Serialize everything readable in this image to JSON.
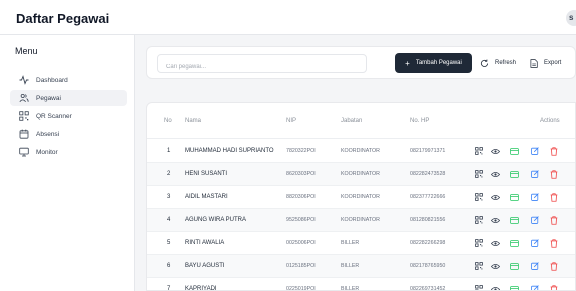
{
  "app": {
    "title": "Daftar Pegawai",
    "avatar_initial": "s"
  },
  "sidebar": {
    "menu_title": "Menu",
    "items": [
      {
        "label": "Dashboard",
        "icon": "activity-icon",
        "active": false
      },
      {
        "label": "Pegawai",
        "icon": "users-icon",
        "active": true
      },
      {
        "label": "QR Scanner",
        "icon": "qr-code-icon",
        "active": false
      },
      {
        "label": "Absensi",
        "icon": "calendar-icon",
        "active": false
      },
      {
        "label": "Monitor",
        "icon": "monitor-icon",
        "active": false
      }
    ]
  },
  "toolbar": {
    "search_placeholder": "Cari pegawai...",
    "add_label": "Tambah Pegawai",
    "add_icon": "plus-icon",
    "refresh_label": "Refresh",
    "refresh_icon": "refresh-icon",
    "export_label": "Export",
    "export_icon": "file-icon"
  },
  "table": {
    "headers": [
      "No",
      "Nama",
      "NIP",
      "Jabatan",
      "No. HP",
      "Actions"
    ],
    "rows": [
      {
        "no": "1",
        "nama": "MUHAMMAD HADI SUPRIANTO",
        "nip": "7820322POI",
        "jabatan": "KOORDINATOR",
        "hp": "082179971371"
      },
      {
        "no": "2",
        "nama": "HENI SUSANTI",
        "nip": "8620303POI",
        "jabatan": "KOORDINATOR",
        "hp": "082282473528"
      },
      {
        "no": "3",
        "nama": "AIDIL MASTARI",
        "nip": "8820306POI",
        "jabatan": "KOORDINATOR",
        "hp": "082377722666"
      },
      {
        "no": "4",
        "nama": "AGUNG WIRA PUTRA",
        "nip": "9525086POI",
        "jabatan": "KOORDINATOR",
        "hp": "081280821556"
      },
      {
        "no": "5",
        "nama": "RINTI AWALIA",
        "nip": "0025006POI",
        "jabatan": "BILLER",
        "hp": "082282266298"
      },
      {
        "no": "6",
        "nama": "BAYU AGUSTI",
        "nip": "0125185POI",
        "jabatan": "BILLER",
        "hp": "082178765950"
      },
      {
        "no": "7",
        "nama": "KAPRIYADI",
        "nip": "0225019POI",
        "jabatan": "BILLER",
        "hp": "082269731452"
      }
    ],
    "action_icons": [
      "qr-code-icon",
      "eye-icon",
      "card-icon",
      "edit-icon",
      "trash-icon"
    ]
  },
  "colors": {
    "primary_button": "#1f2937",
    "qr_icon": "#374151",
    "view_icon": "#374151",
    "card_icon": "#22c55e",
    "edit_icon": "#3b82f6",
    "delete_icon": "#ef4444"
  }
}
